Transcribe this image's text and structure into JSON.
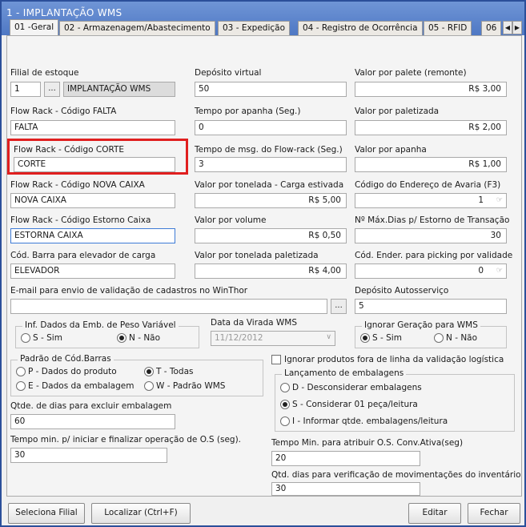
{
  "window": {
    "title": "1 - IMPLANTAÇÃO WMS"
  },
  "tabs": [
    {
      "label": "01 -Geral"
    },
    {
      "label": "02 - Armazenagem/Abastecimento"
    },
    {
      "label": "03 - Expedição"
    },
    {
      "label": "04 - Registro de Ocorrência"
    },
    {
      "label": "05 - RFID"
    },
    {
      "label": "06"
    }
  ],
  "tab_scroll": {
    "left": "◀",
    "right": "▶"
  },
  "fields": {
    "filial": {
      "label": "Filial de estoque",
      "code": "1",
      "button": "...",
      "name": "IMPLANTAÇÃO WMS"
    },
    "deposito_virtual": {
      "label": "Depósito virtual",
      "value": "50"
    },
    "valor_palete": {
      "label": "Valor por palete (remonte)",
      "value": "R$ 3,00"
    },
    "flow_falta": {
      "label": "Flow Rack  - Código FALTA",
      "value": "FALTA"
    },
    "tempo_apanha": {
      "label": "Tempo por apanha (Seg.)",
      "value": "0"
    },
    "valor_paletizada": {
      "label": "Valor por paletizada",
      "value": "R$ 2,00"
    },
    "flow_corte": {
      "label": "Flow Rack  - Código CORTE",
      "value": "CORTE"
    },
    "tempo_msg": {
      "label": "Tempo de msg. do Flow-rack (Seg.)",
      "value": "3"
    },
    "valor_apanha": {
      "label": "Valor por apanha",
      "value": "R$ 1,00"
    },
    "flow_nova_caixa": {
      "label": "Flow Rack  - Código NOVA CAIXA",
      "value": "NOVA CAIXA"
    },
    "valor_tonelada_estivada": {
      "label": "Valor por tonelada - Carga estivada",
      "value": "R$ 5,00"
    },
    "endereco_avaria": {
      "label": "Código do Endereço de Avaria (F3)",
      "value": "1"
    },
    "flow_estorno": {
      "label": "Flow Rack  - Código Estorno Caixa",
      "value": "ESTORNA CAIXA"
    },
    "valor_volume": {
      "label": "Valor por volume",
      "value": "R$ 0,50"
    },
    "max_dias_estorno": {
      "label": "Nº Máx.Dias p/ Estorno de Transação",
      "value": "30"
    },
    "cod_barra_elevador": {
      "label": "Cód. Barra para elevador de carga",
      "value": "ELEVADOR"
    },
    "valor_tonelada_paletizada": {
      "label": "Valor por tonelada paletizada",
      "value": "R$ 4,00"
    },
    "ender_picking": {
      "label": "Cód. Ender. para picking por validade",
      "value": "0"
    },
    "email_validacao": {
      "label": "E-mail para envio de validação de cadastros no WinThor",
      "value": "",
      "button": "..."
    },
    "deposito_autoservico": {
      "label": "Depósito Autosserviço",
      "value": "5"
    },
    "data_virada": {
      "label": "Data da Virada WMS",
      "value": "11/12/2012",
      "arrow": "∨"
    },
    "qtde_dias_excluir": {
      "label": "Qtde. de dias para excluir embalagem",
      "value": "60"
    },
    "tempo_min_os": {
      "label": "Tempo min. p/ iniciar e finalizar operação de O.S (seg).",
      "value": "30"
    },
    "tempo_conv_ativa": {
      "label": "Tempo Min. para atribuir O.S. Conv.Ativa(seg)",
      "value": "20"
    },
    "qtd_dias_inventario": {
      "label": "Qtd. dias para verificação de movimentações do inventário",
      "value": "30"
    }
  },
  "groups": {
    "peso_variavel": {
      "title": "Inf. Dados da Emb. de Peso Variável",
      "options": [
        "S - Sim",
        "N - Não"
      ],
      "selected": "N - Não"
    },
    "ignorar_geracao": {
      "title": "Ignorar Geração para WMS",
      "options": [
        "S - Sim",
        "N - Não"
      ],
      "selected": "S - Sim"
    },
    "padrao_barras": {
      "title": "Padrão de Cód.Barras",
      "options": [
        "P - Dados do produto",
        "T - Todas",
        "E - Dados da embalagem",
        "W - Padrão WMS"
      ],
      "selected": "T - Todas"
    },
    "lancamento": {
      "title": "Lançamento de embalagens",
      "options": [
        "D - Desconsiderar embalagens",
        "S - Considerar 01 peça/leitura",
        "I - Informar qtde. embalagens/leitura"
      ],
      "selected": "S - Considerar 01 peça/leitura"
    }
  },
  "checkbox_ignorar": {
    "label": "Ignorar produtos fora de linha da validação logística",
    "checked": false
  },
  "buttons": {
    "seleciona_filial": "Seleciona Filial",
    "localizar": "Localizar (Ctrl+F)",
    "editar": "Editar",
    "fechar": "Fechar"
  },
  "colors": {
    "title_bar": "#5a82cc",
    "highlight": "#e01f1f"
  }
}
